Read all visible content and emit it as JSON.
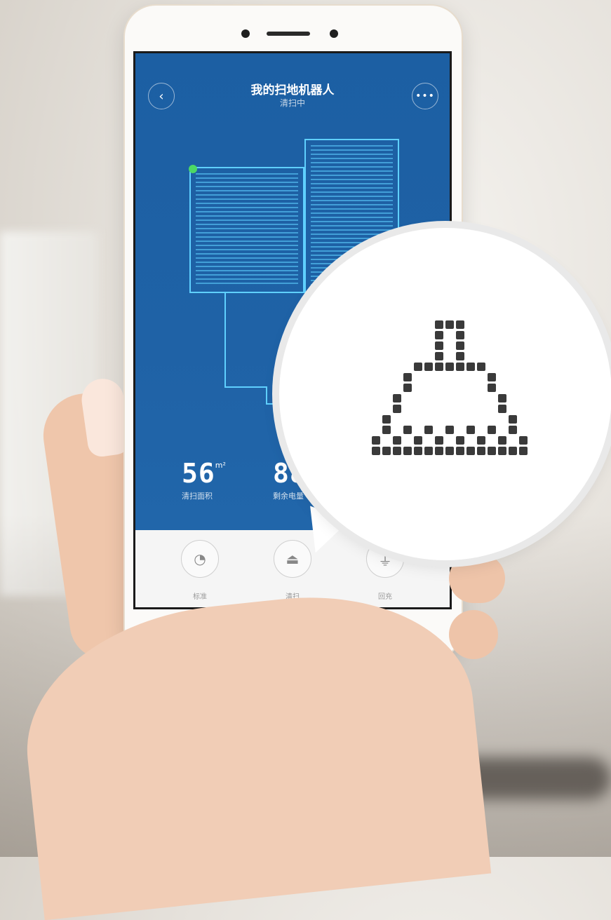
{
  "header": {
    "title": "我的扫地机器人",
    "status": "清扫中"
  },
  "stats": [
    {
      "value": "56",
      "unit": "m²",
      "label": "清扫面积"
    },
    {
      "value": "88",
      "unit": "",
      "label": "剩余电量"
    }
  ],
  "toolbar": [
    {
      "label": "标准",
      "icon": "fan-speed-icon"
    },
    {
      "label": "清扫",
      "icon": "broom-icon"
    },
    {
      "label": "回充",
      "icon": "charging-plug-icon"
    }
  ],
  "nav": {
    "menu": "≡",
    "home": "□",
    "back": "‹"
  },
  "colors": {
    "app_bg": "#1f62a6",
    "map_line": "#5fd0ff",
    "dock": "#4cd964",
    "pixel_icon": "#3a3a3a"
  }
}
